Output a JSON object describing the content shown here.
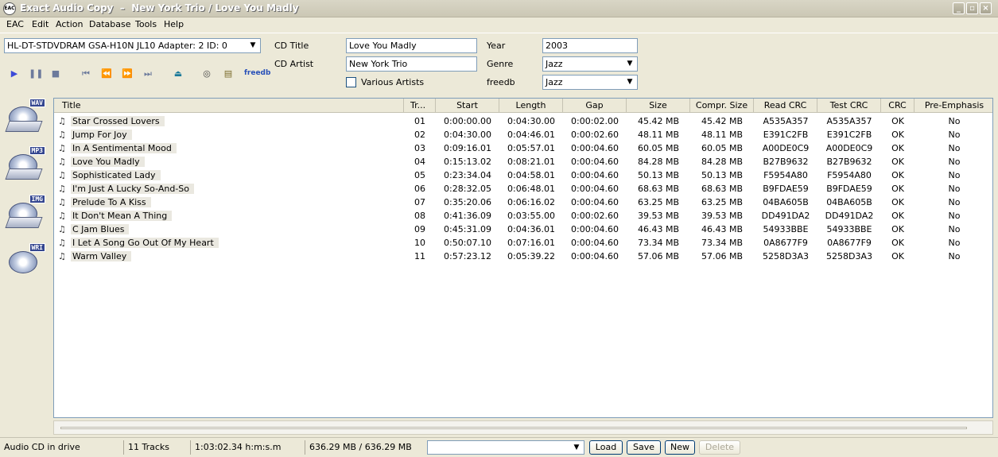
{
  "window": {
    "title": "Exact Audio Copy  –  New York Trio / Love You Madly",
    "app_icon": "EAC"
  },
  "menu": [
    "EAC",
    "Edit",
    "Action",
    "Database",
    "Tools",
    "Help"
  ],
  "drive": {
    "selected": "HL-DT-STDVDRAM GSA-H10N JL10  Adapter: 2  ID: 0"
  },
  "toolbar": {
    "freedb_label": "freedb"
  },
  "cd_info": {
    "title_label": "CD Title",
    "title_value": "Love You Madly",
    "artist_label": "CD Artist",
    "artist_value": "New York Trio",
    "various_artists_label": "Various Artists",
    "year_label": "Year",
    "year_value": "2003",
    "genre_label": "Genre",
    "genre_value": "Jazz",
    "freedb_label": "freedb",
    "freedb_value": "Jazz"
  },
  "side_icons": [
    {
      "badge": "WAV",
      "icon": "wav-copy-icon"
    },
    {
      "badge": "MP3",
      "icon": "mp3-compress-icon"
    },
    {
      "badge": "IMG",
      "icon": "image-copy-icon"
    },
    {
      "badge": "WRI",
      "icon": "write-cd-icon"
    }
  ],
  "columns": [
    "Title",
    "Tr...",
    "Start",
    "Length",
    "Gap",
    "Size",
    "Compr. Size",
    "Read CRC",
    "Test CRC",
    "CRC",
    "Pre-Emphasis"
  ],
  "tracks": [
    {
      "title": "Star Crossed Lovers",
      "track": "01",
      "start": "0:00:00.00",
      "length": "0:04:30.00",
      "gap": "0:00:02.00",
      "size": "45.42 MB",
      "compr": "45.42 MB",
      "read_crc": "A535A357",
      "test_crc": "A535A357",
      "crc": "OK",
      "pre": "No"
    },
    {
      "title": "Jump For Joy",
      "track": "02",
      "start": "0:04:30.00",
      "length": "0:04:46.01",
      "gap": "0:00:02.60",
      "size": "48.11 MB",
      "compr": "48.11 MB",
      "read_crc": "E391C2FB",
      "test_crc": "E391C2FB",
      "crc": "OK",
      "pre": "No"
    },
    {
      "title": "In A Sentimental Mood",
      "track": "03",
      "start": "0:09:16.01",
      "length": "0:05:57.01",
      "gap": "0:00:04.60",
      "size": "60.05 MB",
      "compr": "60.05 MB",
      "read_crc": "A00DE0C9",
      "test_crc": "A00DE0C9",
      "crc": "OK",
      "pre": "No"
    },
    {
      "title": "Love You Madly",
      "track": "04",
      "start": "0:15:13.02",
      "length": "0:08:21.01",
      "gap": "0:00:04.60",
      "size": "84.28 MB",
      "compr": "84.28 MB",
      "read_crc": "B27B9632",
      "test_crc": "B27B9632",
      "crc": "OK",
      "pre": "No"
    },
    {
      "title": "Sophisticated Lady",
      "track": "05",
      "start": "0:23:34.04",
      "length": "0:04:58.01",
      "gap": "0:00:04.60",
      "size": "50.13 MB",
      "compr": "50.13 MB",
      "read_crc": "F5954A80",
      "test_crc": "F5954A80",
      "crc": "OK",
      "pre": "No"
    },
    {
      "title": "I'm Just A Lucky So-And-So",
      "track": "06",
      "start": "0:28:32.05",
      "length": "0:06:48.01",
      "gap": "0:00:04.60",
      "size": "68.63 MB",
      "compr": "68.63 MB",
      "read_crc": "B9FDAE59",
      "test_crc": "B9FDAE59",
      "crc": "OK",
      "pre": "No"
    },
    {
      "title": "Prelude To A Kiss",
      "track": "07",
      "start": "0:35:20.06",
      "length": "0:06:16.02",
      "gap": "0:00:04.60",
      "size": "63.25 MB",
      "compr": "63.25 MB",
      "read_crc": "04BA605B",
      "test_crc": "04BA605B",
      "crc": "OK",
      "pre": "No"
    },
    {
      "title": "It Don't Mean A Thing",
      "track": "08",
      "start": "0:41:36.09",
      "length": "0:03:55.00",
      "gap": "0:00:02.60",
      "size": "39.53 MB",
      "compr": "39.53 MB",
      "read_crc": "DD491DA2",
      "test_crc": "DD491DA2",
      "crc": "OK",
      "pre": "No"
    },
    {
      "title": "C Jam Blues",
      "track": "09",
      "start": "0:45:31.09",
      "length": "0:04:36.01",
      "gap": "0:00:04.60",
      "size": "46.43 MB",
      "compr": "46.43 MB",
      "read_crc": "54933BBE",
      "test_crc": "54933BBE",
      "crc": "OK",
      "pre": "No"
    },
    {
      "title": "I Let A Song Go Out Of My Heart",
      "track": "10",
      "start": "0:50:07.10",
      "length": "0:07:16.01",
      "gap": "0:00:04.60",
      "size": "73.34 MB",
      "compr": "73.34 MB",
      "read_crc": "0A8677F9",
      "test_crc": "0A8677F9",
      "crc": "OK",
      "pre": "No"
    },
    {
      "title": "Warm Valley",
      "track": "11",
      "start": "0:57:23.12",
      "length": "0:05:39.22",
      "gap": "0:00:04.60",
      "size": "57.06 MB",
      "compr": "57.06 MB",
      "read_crc": "5258D3A3",
      "test_crc": "5258D3A3",
      "crc": "OK",
      "pre": "No"
    }
  ],
  "status": {
    "drive_state": "Audio CD in drive",
    "tracks": "11 Tracks",
    "duration": "1:03:02.34 h:m:s.m",
    "size": "636.29 MB / 636.29 MB",
    "profile_value": "",
    "load": "Load",
    "save": "Save",
    "new": "New",
    "delete": "Delete"
  }
}
